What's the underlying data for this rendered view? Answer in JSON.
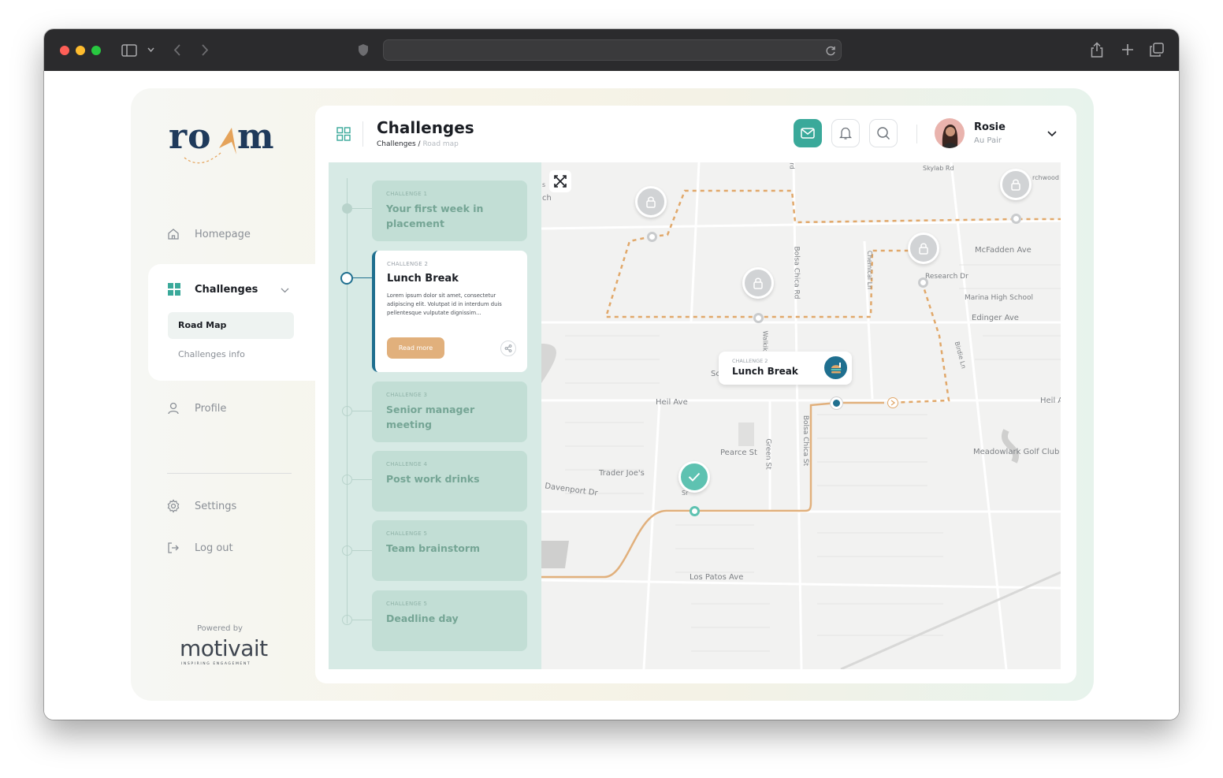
{
  "browser": {
    "url": ""
  },
  "app": {
    "logo_text": "roam",
    "powered_by": "Powered by",
    "brand": "motivait",
    "brand_tagline": "INSPIRING ENGAGEMENT"
  },
  "sidebar": {
    "homepage": "Homepage",
    "challenges": "Challenges",
    "road_map": "Road Map",
    "challenges_info": "Challenges info",
    "profile": "Profile",
    "settings": "Settings",
    "logout": "Log out"
  },
  "header": {
    "title": "Challenges",
    "breadcrumb_root": "Challenges",
    "breadcrumb_sep": " / ",
    "breadcrumb_current": "Road map",
    "user_name": "Rosie",
    "user_role": "Au Pair"
  },
  "challenges": [
    {
      "kicker": "CHALLENGE 1",
      "title": "Your first week in placement"
    },
    {
      "kicker": "CHALLENGE 2",
      "title": "Lunch Break",
      "body": "Lorem ipsum dolor sit amet, consectetur adipiscing elit. Volutpat id in interdum duis pellentesque vulputate dignissim...",
      "button": "Read more"
    },
    {
      "kicker": "CHALLENGE 3",
      "title": "Senior manager meeting"
    },
    {
      "kicker": "CHALLENGE 4",
      "title": "Post work drinks"
    },
    {
      "kicker": "CHALLENGE 5",
      "title": "Team brainstorm"
    },
    {
      "kicker": "CHALLENGE 5",
      "title": "Deadline day"
    }
  ],
  "map": {
    "popup_kicker": "CHALLENGE 2",
    "popup_title": "Lunch Break",
    "labels": [
      "Skylab Rd",
      "rchwood",
      "McFadden Ave",
      "Research Dr",
      "Marina High School",
      "Edinger Ave",
      "Bolsa Chica Rd",
      "Chemical Ln",
      "Walkik",
      "Birdie Ln",
      "Heil Ave",
      "Heil A",
      "Sc",
      "Pearce St",
      "Green St",
      "Bolsa Chica St",
      "Trader Joe's",
      "Davenport Dr",
      "Meadowlark Golf Club",
      "Los Patos Ave",
      "ch",
      "s",
      "Sr",
      "rd"
    ],
    "colors": {
      "route_done": "#e1b07c",
      "route_locked": "#e1a86a",
      "accent": "#3aa99a",
      "active": "#1f6f8f"
    }
  }
}
